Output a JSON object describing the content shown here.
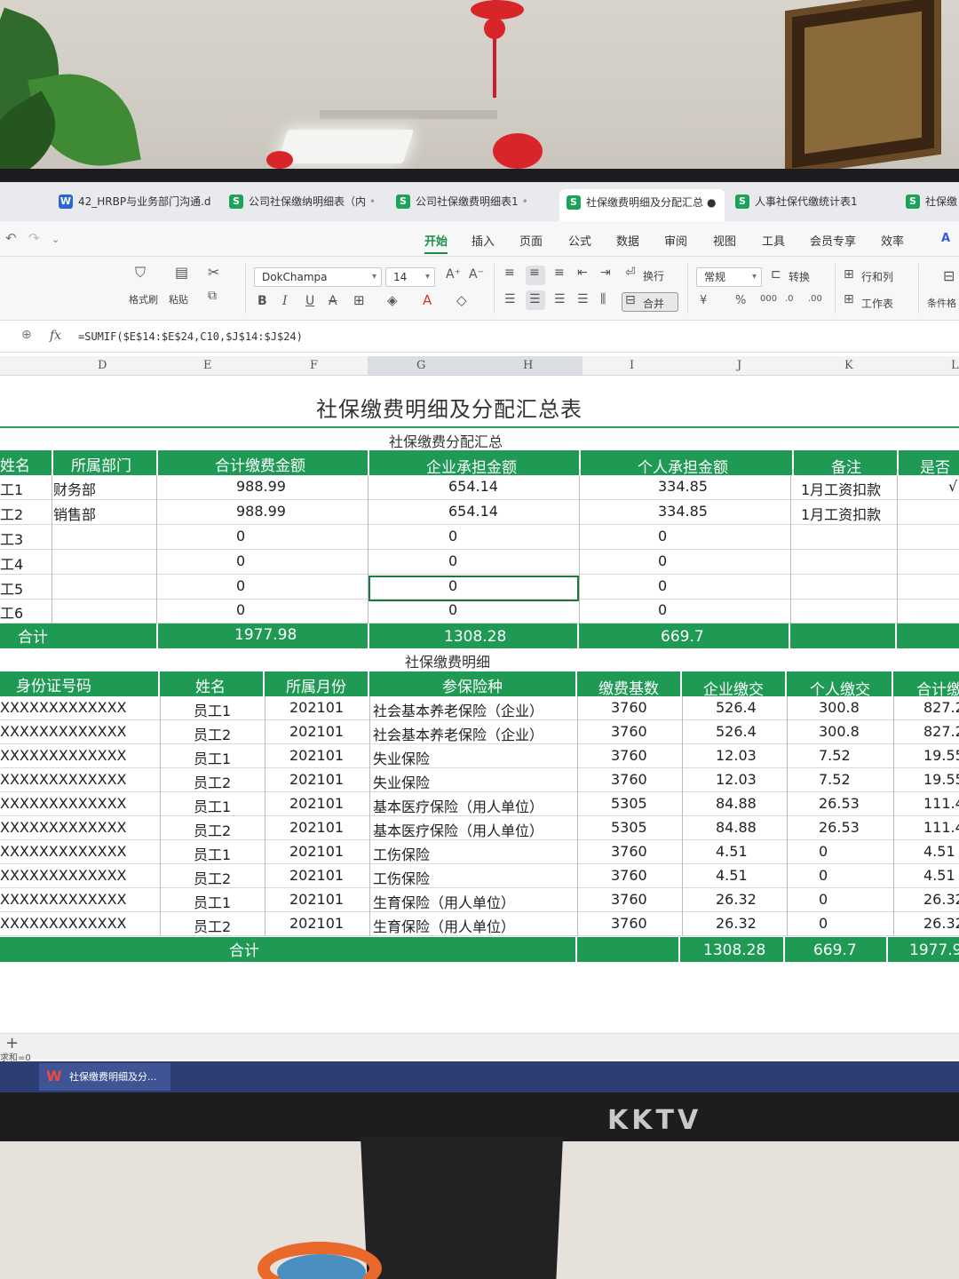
{
  "tabs": [
    {
      "icon": "W",
      "label": "42_HRBP与业务部门沟通.d"
    },
    {
      "icon": "S",
      "label": "公司社保缴纳明细表（内"
    },
    {
      "icon": "S",
      "label": "公司社保缴费明细表1"
    },
    {
      "icon": "S",
      "label": "社保缴费明细及分配汇总"
    },
    {
      "icon": "S",
      "label": "人事社保代缴统计表1"
    },
    {
      "icon": "S",
      "label": "社保缴"
    }
  ],
  "menu": [
    "开始",
    "插入",
    "页面",
    "公式",
    "数据",
    "审阅",
    "视图",
    "工具",
    "会员专享",
    "效率"
  ],
  "ribbon": {
    "format_painter": "格式刷",
    "paste": "粘贴",
    "font": "DokChampa",
    "size": "14",
    "wrap": "换行",
    "merge": "合并",
    "number_format": "常规",
    "convert": "转换",
    "row_col": "行和列",
    "worksheet": "工作表",
    "conditional": "条件格"
  },
  "formula_bar": {
    "fx": "fx",
    "formula": "=SUMIF($E$14:$E$24,C10,$J$14:$J$24)"
  },
  "columns": [
    "D",
    "E",
    "F",
    "G",
    "H",
    "I",
    "J",
    "K",
    "L"
  ],
  "sheet": {
    "title": "社保缴费明细及分配汇总表",
    "summary": {
      "subtitle": "社保缴费分配汇总",
      "headers": [
        "姓名",
        "所属部门",
        "合计缴费金额",
        "企业承担金额",
        "个人承担金额",
        "备注",
        "是否"
      ],
      "rows": [
        [
          "工1",
          "财务部",
          "988.99",
          "654.14",
          "334.85",
          "1月工资扣款",
          "√"
        ],
        [
          "工2",
          "销售部",
          "988.99",
          "654.14",
          "334.85",
          "1月工资扣款",
          ""
        ],
        [
          "工3",
          "",
          "0",
          "0",
          "0",
          "",
          ""
        ],
        [
          "工4",
          "",
          "0",
          "0",
          "0",
          "",
          ""
        ],
        [
          "工5",
          "",
          "0",
          "0",
          "0",
          "",
          ""
        ],
        [
          "工6",
          "",
          "0",
          "0",
          "0",
          "",
          ""
        ]
      ],
      "total": {
        "label": "合计",
        "total": "1977.98",
        "company": "1308.28",
        "personal": "669.7"
      }
    },
    "detail": {
      "subtitle": "社保缴费明细",
      "headers": [
        "身份证号码",
        "姓名",
        "所属月份",
        "参保险种",
        "缴费基数",
        "企业缴交",
        "个人缴交",
        "合计缴"
      ],
      "rows": [
        [
          "XXXXXXXXXXXXX",
          "员工1",
          "202101",
          "社会基本养老保险（企业）",
          "3760",
          "526.4",
          "300.8",
          "827.2"
        ],
        [
          "XXXXXXXXXXXXX",
          "员工2",
          "202101",
          "社会基本养老保险（企业）",
          "3760",
          "526.4",
          "300.8",
          "827.2"
        ],
        [
          "XXXXXXXXXXXXX",
          "员工1",
          "202101",
          "失业保险",
          "3760",
          "12.03",
          "7.52",
          "19.55"
        ],
        [
          "XXXXXXXXXXXXX",
          "员工2",
          "202101",
          "失业保险",
          "3760",
          "12.03",
          "7.52",
          "19.55"
        ],
        [
          "XXXXXXXXXXXXX",
          "员工1",
          "202101",
          "基本医疗保险（用人单位）",
          "5305",
          "84.88",
          "26.53",
          "111.4"
        ],
        [
          "XXXXXXXXXXXXX",
          "员工2",
          "202101",
          "基本医疗保险（用人单位）",
          "5305",
          "84.88",
          "26.53",
          "111.4"
        ],
        [
          "XXXXXXXXXXXXX",
          "员工1",
          "202101",
          "工伤保险",
          "3760",
          "4.51",
          "0",
          "4.51"
        ],
        [
          "XXXXXXXXXXXXX",
          "员工2",
          "202101",
          "工伤保险",
          "3760",
          "4.51",
          "0",
          "4.51"
        ],
        [
          "XXXXXXXXXXXXX",
          "员工1",
          "202101",
          "生育保险（用人单位）",
          "3760",
          "26.32",
          "0",
          "26.32"
        ],
        [
          "XXXXXXXXXXXXX",
          "员工2",
          "202101",
          "生育保险（用人单位）",
          "3760",
          "26.32",
          "0",
          "26.32"
        ]
      ],
      "total": {
        "label": "合计",
        "company": "1308.28",
        "personal": "669.7",
        "total": "1977.9"
      }
    }
  },
  "status": {
    "sum_label": "求和=0"
  },
  "taskbar": {
    "app_label": "社保缴费明细及分..."
  },
  "monitor_brand": "KKTV",
  "colors": {
    "header_green": "#1f9a55",
    "active_tab": "#1b8d4b",
    "taskbar": "#2c3e73"
  }
}
